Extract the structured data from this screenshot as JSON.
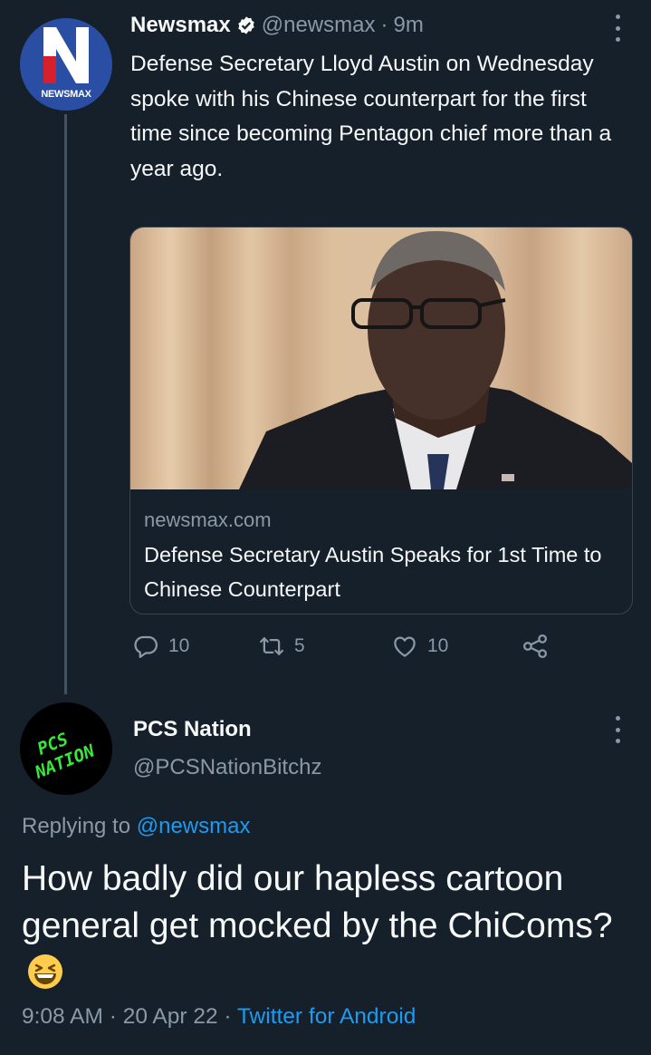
{
  "tweet": {
    "avatar_brand": "NEWSMAX",
    "name": "Newsmax",
    "handle": "@newsmax",
    "separator": "·",
    "time": "9m",
    "text": "Defense Secretary Lloyd Austin on Wednesday spoke with his Chinese counterpart for the first time since becoming Pentagon chief more than a year ago.",
    "card": {
      "domain": "newsmax.com",
      "title": "Defense Secretary Austin Speaks for 1st Time to Chinese Counterpart"
    },
    "actions": {
      "replies": "10",
      "retweets": "5",
      "likes": "10"
    }
  },
  "reply": {
    "avatar_text_1": "PCS",
    "avatar_text_2": "NATION",
    "name": "PCS Nation",
    "handle": "@PCSNationBitchz",
    "replying_prefix": "Replying to",
    "replying_to": "@newsmax",
    "text": "How badly did our hapless cartoon general get mocked by the ChiComs?",
    "time": "9:08 AM",
    "separator": "·",
    "date": "20 Apr 22",
    "source": "Twitter for Android"
  },
  "colors": {
    "background": "#15202b",
    "text": "#f7f9f9",
    "muted": "#8b98a5",
    "link": "#1d9bf0",
    "verified": "#f7f9f9",
    "avatar_brand": "#2b4ea5",
    "pcs_green": "#39e639"
  },
  "icons": [
    "verified-icon",
    "more-icon",
    "reply-icon",
    "retweet-icon",
    "like-icon",
    "share-icon",
    "laughing-emoji"
  ]
}
